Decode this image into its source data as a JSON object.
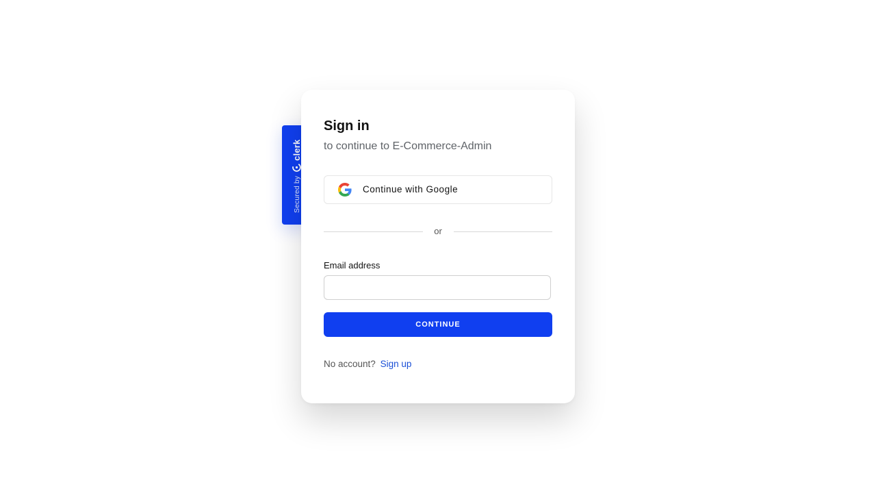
{
  "badge": {
    "secured_by": "Secured by",
    "brand": "clerk",
    "logo_icon": "clerk-logo-icon"
  },
  "signin": {
    "title": "Sign in",
    "subtitle": "to continue to E-Commerce-Admin",
    "google_button": "Continue with Google",
    "google_icon": "google-g-icon",
    "divider": "or",
    "email_label": "Email address",
    "email_value": "",
    "email_placeholder": "",
    "continue_button": "CONTINUE",
    "no_account": "No account?",
    "signup_link": "Sign up"
  },
  "colors": {
    "accent": "#103ff0",
    "link": "#1a4fd6",
    "text": "#111111",
    "muted": "#5f6368"
  }
}
